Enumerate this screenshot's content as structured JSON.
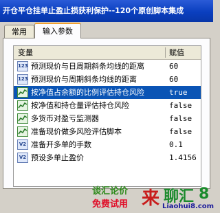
{
  "window": {
    "title": "开仓平仓挂单止盈止损获利保护--120个原创脚本集成"
  },
  "tabs": [
    {
      "label": "常用",
      "active": false
    },
    {
      "label": "输入参数",
      "active": true
    }
  ],
  "table": {
    "columns": [
      "变量",
      "赋值"
    ],
    "rows": [
      {
        "icon": "number-icon",
        "name": "预测现价与日周期斜条均线的距离",
        "value": "60",
        "selected": false
      },
      {
        "icon": "number-icon",
        "name": "预测现价与周期斜条均线的距离",
        "value": "60",
        "selected": false
      },
      {
        "icon": "wave-icon",
        "name": "按净值占余额的比例评估持仓风险",
        "value": "true",
        "selected": true
      },
      {
        "icon": "wave-icon",
        "name": "按净值和持仓量评估持仓风险",
        "value": "false",
        "selected": false
      },
      {
        "icon": "wave-icon",
        "name": "多货币对盈亏监测器",
        "value": "false",
        "selected": false
      },
      {
        "icon": "wave-icon",
        "name": "准备现价做多风险评估脚本",
        "value": "false",
        "selected": false
      },
      {
        "icon": "decimal-icon",
        "name": "准备开多单的手数",
        "value": "0.1",
        "selected": false
      },
      {
        "icon": "decimal-icon",
        "name": "预设多单止盈价",
        "value": "1.4156",
        "selected": false
      }
    ]
  },
  "ad": {
    "line1": "谈汇论价",
    "line2": "免费试用",
    "char1": "来",
    "char2": "聊汇",
    "char3": "8",
    "url": "Liaohui8.com"
  },
  "colors": {
    "title_bg": "#0a3fbf",
    "selection": "#0a54b5",
    "tab_highlight": "#f0a030"
  }
}
